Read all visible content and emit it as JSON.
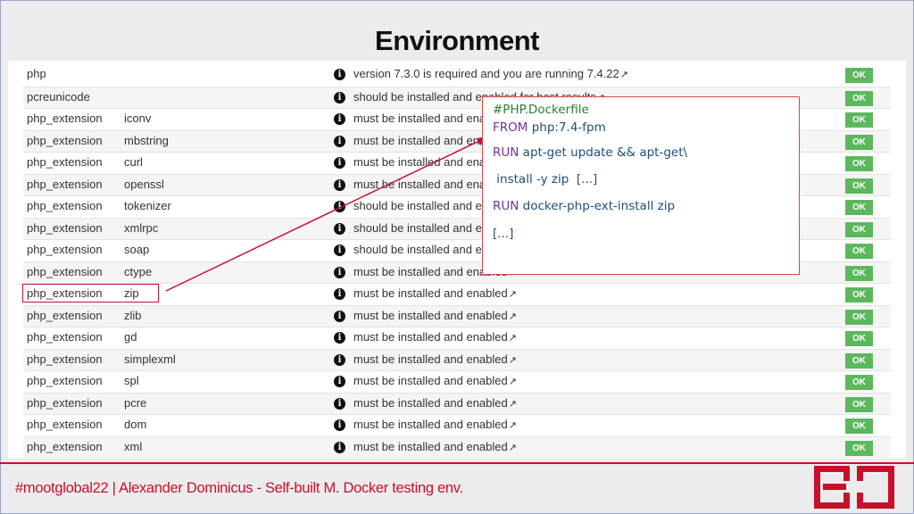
{
  "slide": {
    "title": "Environment"
  },
  "environment_table": {
    "rows": [
      {
        "type": "php",
        "name": "",
        "message": "version 7.3.0 is required and you are running 7.4.22",
        "status": "OK"
      },
      {
        "type": "pcreunicode",
        "name": "",
        "message": "should be installed and enabled for best results",
        "status": "OK"
      },
      {
        "type": "php_extension",
        "name": "iconv",
        "message": "must be installed and enabled",
        "status": "OK"
      },
      {
        "type": "php_extension",
        "name": "mbstring",
        "message": "must be installed and enabled",
        "status": "OK"
      },
      {
        "type": "php_extension",
        "name": "curl",
        "message": "must be installed and enabled",
        "status": "OK"
      },
      {
        "type": "php_extension",
        "name": "openssl",
        "message": "must be installed and enabled",
        "status": "OK"
      },
      {
        "type": "php_extension",
        "name": "tokenizer",
        "message": "should be installed and enabled for best results",
        "status": "OK"
      },
      {
        "type": "php_extension",
        "name": "xmlrpc",
        "message": "should be installed and enabled for best results",
        "status": "OK"
      },
      {
        "type": "php_extension",
        "name": "soap",
        "message": "should be installed and enabled for best results",
        "status": "OK"
      },
      {
        "type": "php_extension",
        "name": "ctype",
        "message": "must be installed and enabled",
        "status": "OK"
      },
      {
        "type": "php_extension",
        "name": "zip",
        "message": "must be installed and enabled",
        "status": "OK"
      },
      {
        "type": "php_extension",
        "name": "zlib",
        "message": "must be installed and enabled",
        "status": "OK"
      },
      {
        "type": "php_extension",
        "name": "gd",
        "message": "must be installed and enabled",
        "status": "OK"
      },
      {
        "type": "php_extension",
        "name": "simplexml",
        "message": "must be installed and enabled",
        "status": "OK"
      },
      {
        "type": "php_extension",
        "name": "spl",
        "message": "must be installed and enabled",
        "status": "OK"
      },
      {
        "type": "php_extension",
        "name": "pcre",
        "message": "must be installed and enabled",
        "status": "OK"
      },
      {
        "type": "php_extension",
        "name": "dom",
        "message": "must be installed and enabled",
        "status": "OK"
      },
      {
        "type": "php_extension",
        "name": "xml",
        "message": "must be installed and enabled",
        "status": "OK"
      }
    ],
    "info_icon": "info-circle-icon",
    "link_icon": "external-link-icon",
    "highlighted_row": "php_extension zip"
  },
  "callout": {
    "comment": "#PHP.Dockerfile",
    "line1_kw": "FROM",
    "line1_val": " php:7.4-fpm",
    "line2_kw": "RUN",
    "line2_val": " apt-get update && apt-get\\",
    "line3_val": " install -y zip  [...]",
    "line4_kw": "RUN",
    "line4_val": " docker-php-ext-install zip",
    "line5_val": "[...]"
  },
  "footer": {
    "text": "#mootglobal22 | Alexander Dominicus - Self-built M. Docker testing env.",
    "logo": "BO"
  },
  "colors": {
    "accent_red": "#c8102e",
    "ok_green": "#5cb85c",
    "keyword_purple": "#7030a0",
    "comment_green": "#2e7d32",
    "code_blue": "#1f4e79"
  }
}
